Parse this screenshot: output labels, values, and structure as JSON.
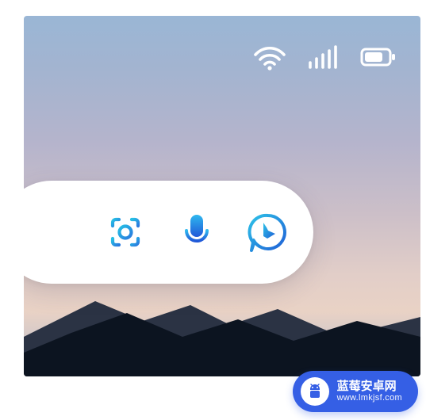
{
  "status_bar": {
    "wifi": {
      "name": "wifi-icon",
      "bars": 3
    },
    "signal": {
      "name": "cellular-signal-icon",
      "bars": 5
    },
    "battery": {
      "name": "battery-icon",
      "level_pct": 70
    }
  },
  "search_widget": {
    "actions": [
      {
        "name": "camera-lens-icon",
        "label": "Visual search"
      },
      {
        "name": "microphone-icon",
        "label": "Voice search"
      },
      {
        "name": "bing-chat-icon",
        "label": "Bing chat"
      }
    ]
  },
  "watermark": {
    "title": "蓝莓安卓网",
    "url": "www.lmkjsf.com",
    "badge_icon": "android-icon"
  },
  "colors": {
    "accent_blue": "#2a7adf",
    "accent_cyan": "#27c0e5",
    "watermark_bg": "#355fe5",
    "status_stroke": "#ffffff"
  }
}
